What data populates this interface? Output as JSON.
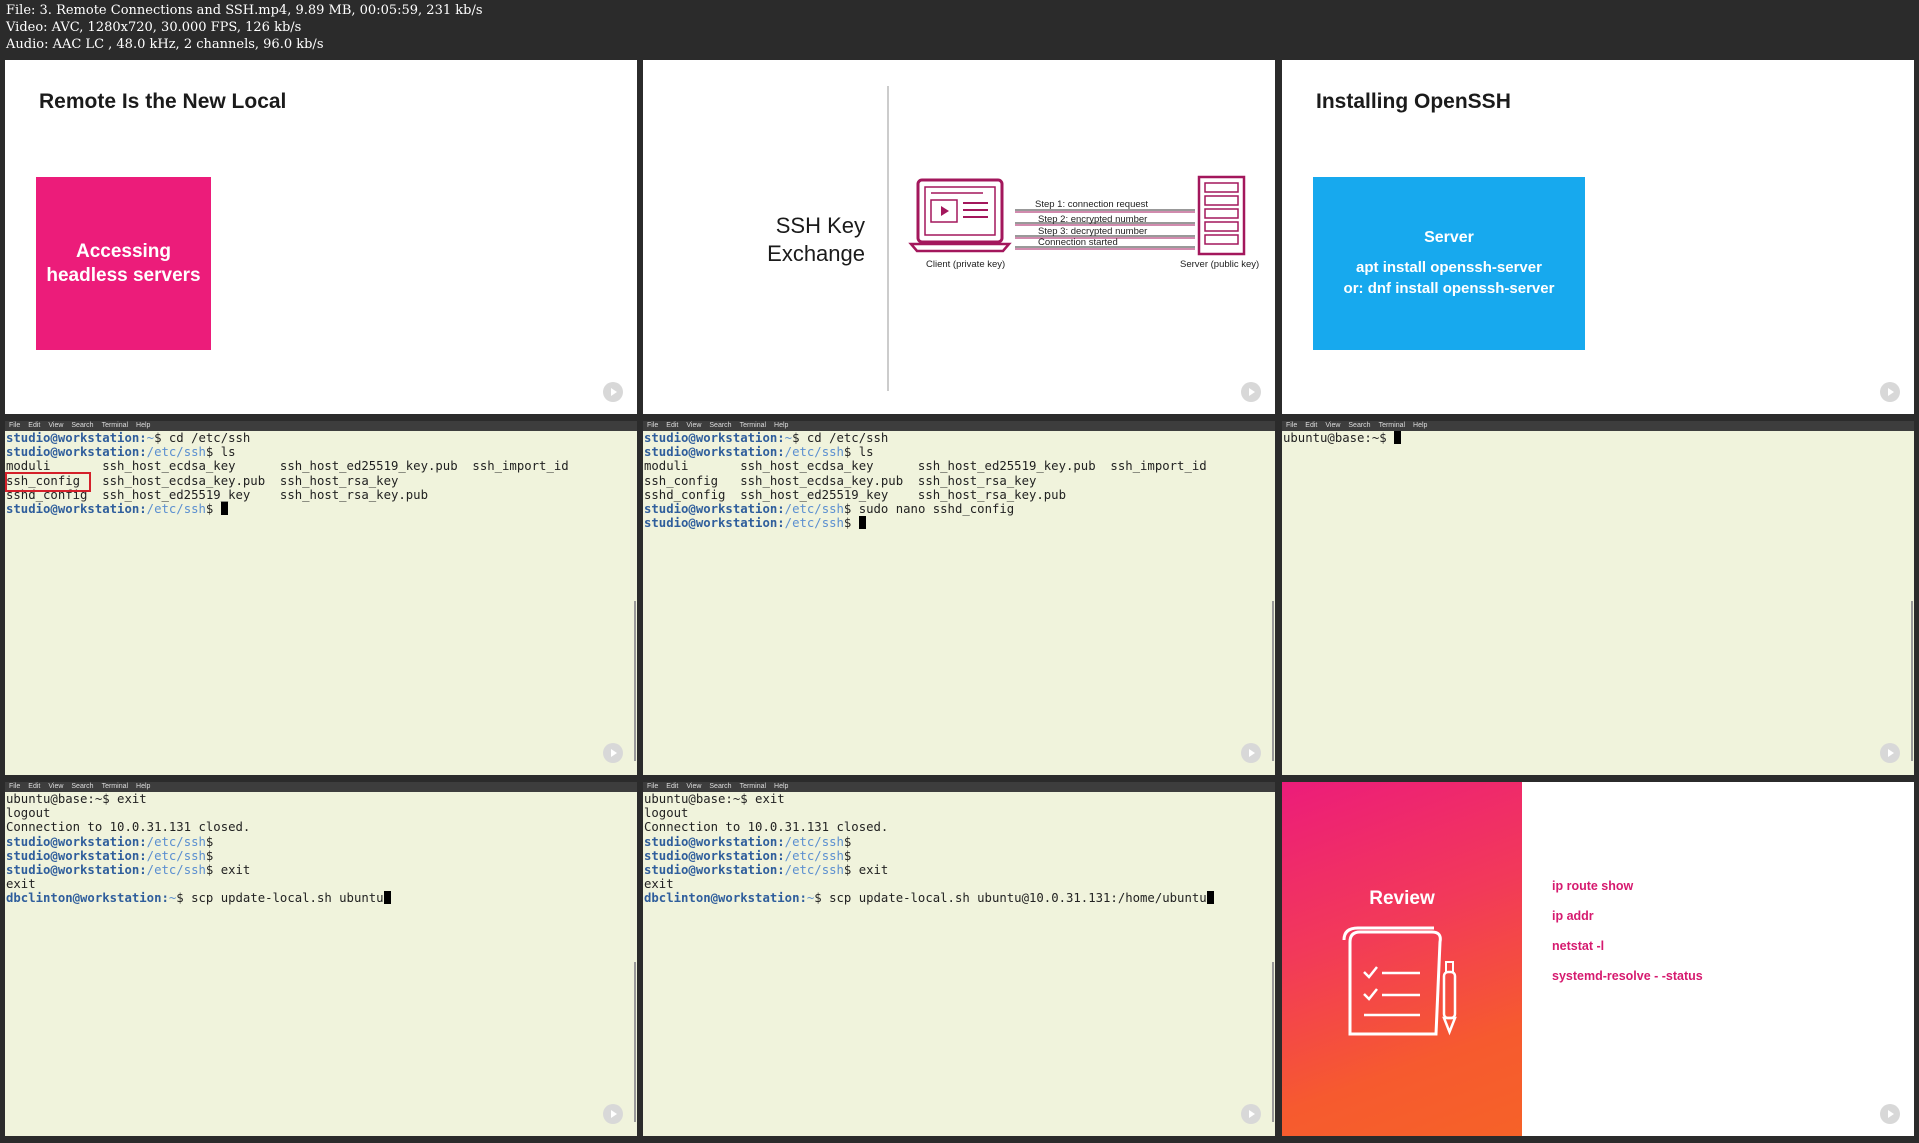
{
  "info": {
    "file_line": "File: 3. Remote Connections and SSH.mp4, 9.89 MB, 00:05:59, 231 kb/s",
    "video_line": "Video: AVC, 1280x720, 30.000 FPS, 126 kb/s",
    "audio_line": "Audio: AAC LC , 48.0 kHz, 2 channels, 96.0 kb/s"
  },
  "menu": [
    "File",
    "Edit",
    "View",
    "Search",
    "Terminal",
    "Help"
  ],
  "slide1": {
    "title": "Remote Is the New Local",
    "box_line1": "Accessing",
    "box_line2": "headless servers"
  },
  "slide2": {
    "title_line1": "SSH Key",
    "title_line2": "Exchange",
    "step1": "Step 1: connection request",
    "step2": "Step 2: encrypted number",
    "step3": "Step 3:  decrypted number",
    "step4": "Connection started",
    "client_label": "Client (private key)",
    "server_label": "Server (public key)"
  },
  "slide3": {
    "title": "Installing OpenSSH",
    "box_title": "Server",
    "cmd1": "apt install openssh-server",
    "cmd2": "or: dnf install openssh-server"
  },
  "term1": {
    "l1_prompt": "studio@workstation:",
    "l1_path": "~",
    "l1_cmd": "$ cd /etc/ssh",
    "l2_prompt": "studio@workstation:",
    "l2_path": "/etc/ssh",
    "l2_cmd": "$ ls",
    "l3": "moduli       ssh_host_ecdsa_key      ssh_host_ed25519_key.pub  ssh_import_id",
    "l4": "ssh_config   ssh_host_ecdsa_key.pub  ssh_host_rsa_key",
    "l5": "sshd_config  ssh_host_ed25519_key    ssh_host_rsa_key.pub",
    "l6_prompt": "studio@workstation:",
    "l6_path": "/etc/ssh",
    "l6_cmd": "$ "
  },
  "term2": {
    "l1_prompt": "studio@workstation:",
    "l1_path": "~",
    "l1_cmd": "$ cd /etc/ssh",
    "l2_prompt": "studio@workstation:",
    "l2_path": "/etc/ssh",
    "l2_cmd": "$ ls",
    "l3": "moduli       ssh_host_ecdsa_key      ssh_host_ed25519_key.pub  ssh_import_id",
    "l4": "ssh_config   ssh_host_ecdsa_key.pub  ssh_host_rsa_key",
    "l5": "sshd_config  ssh_host_ed25519_key    ssh_host_rsa_key.pub",
    "l6_prompt": "studio@workstation:",
    "l6_path": "/etc/ssh",
    "l6_cmd": "$ sudo nano sshd_config",
    "l7_prompt": "studio@workstation:",
    "l7_path": "/etc/ssh",
    "l7_cmd": "$ "
  },
  "term3": {
    "l1": "ubuntu@base:~$ "
  },
  "term4": {
    "l1": "ubuntu@base:~$ exit",
    "l2": "logout",
    "l3": "Connection to 10.0.31.131 closed.",
    "l4_prompt": "studio@workstation:",
    "l4_path": "/etc/ssh",
    "l4_cmd": "$",
    "l5_prompt": "studio@workstation:",
    "l5_path": "/etc/ssh",
    "l5_cmd": "$",
    "l6_prompt": "studio@workstation:",
    "l6_path": "/etc/ssh",
    "l6_cmd": "$ exit",
    "l7": "exit",
    "l8_prompt": "dbclinton@workstation:",
    "l8_path": "~",
    "l8_cmd": "$ scp update-local.sh ubuntu"
  },
  "term5": {
    "l1": "ubuntu@base:~$ exit",
    "l2": "logout",
    "l3": "Connection to 10.0.31.131 closed.",
    "l4_prompt": "studio@workstation:",
    "l4_path": "/etc/ssh",
    "l4_cmd": "$",
    "l5_prompt": "studio@workstation:",
    "l5_path": "/etc/ssh",
    "l5_cmd": "$",
    "l6_prompt": "studio@workstation:",
    "l6_path": "/etc/ssh",
    "l6_cmd": "$ exit",
    "l7": "exit",
    "l8_prompt": "dbclinton@workstation:",
    "l8_path": "~",
    "l8_cmd": "$ scp update-local.sh ubuntu@10.0.31.131:/home/ubuntu"
  },
  "slide4": {
    "title": "Review",
    "cmds": [
      "ip route show",
      "ip addr",
      "netstat -l",
      "systemd-resolve - -status"
    ]
  }
}
